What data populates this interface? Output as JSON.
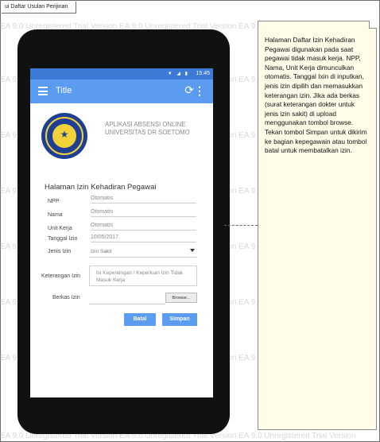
{
  "frame": {
    "label": "ui Daftar Usulan Perijinan"
  },
  "watermark": {
    "text": "EA 9.0 Unregistered Trial Version   EA 9.0 Unregistered Trial Version   EA 9.0 Unregistered Trial Version"
  },
  "statusbar": {
    "time": "15:45",
    "icons": "▼ ◢ ▮"
  },
  "appbar": {
    "title": "Title",
    "refresh_icon": "⟳",
    "more_icon": "⋮"
  },
  "app_name": "APLIKASI ABSENSI ONLINE UNIVERSITAS DR SOETOMO",
  "form": {
    "title": "Halaman Izin Kehadiran Pegawai",
    "npp": {
      "label": "NPP",
      "value": "Otomatis"
    },
    "nama": {
      "label": "Nama",
      "value": "Otomatis"
    },
    "unit": {
      "label": "Unit Kerja",
      "value": "Otomatis"
    },
    "tanggal": {
      "label": "Tanggal Izin",
      "value": "10/05/2017"
    },
    "jenis": {
      "label": "Jenis Izin",
      "value": "Izin Sakit"
    },
    "keterangan": {
      "label": "Keterangan Izin",
      "placeholder": "Isi Kepentingan / Keperluan Izin Tidak Masuk Kerja"
    },
    "berkas": {
      "label": "Berkas Izin",
      "browse": "Browse..."
    },
    "batal": "Batal",
    "simpan": "Simpan"
  },
  "note": {
    "text": "Halaman Daftar Izin Kehadiran Pegawai digunakan pada saat pegawai tidak masuk kerja. NPP, Nama, Unit Kerja dimunculkan otomatis. Tanggal Ixin di inputkan, jenis izin dipilih dan memasukkan keterangan izin. Jika ada berkas (surat keterangan dokter untuk jenis izin sakit) di upload menggunakan tombol browse. Tekan tombol Simpan untuk dikirim ke bagian kepegawain atau tombol batal untuk membatalkan izin."
  },
  "colors": {
    "appbar": "#5b9cf0",
    "statusbar": "#3d7ad6",
    "phone": "#111111",
    "note_bg": "#fffce8"
  }
}
